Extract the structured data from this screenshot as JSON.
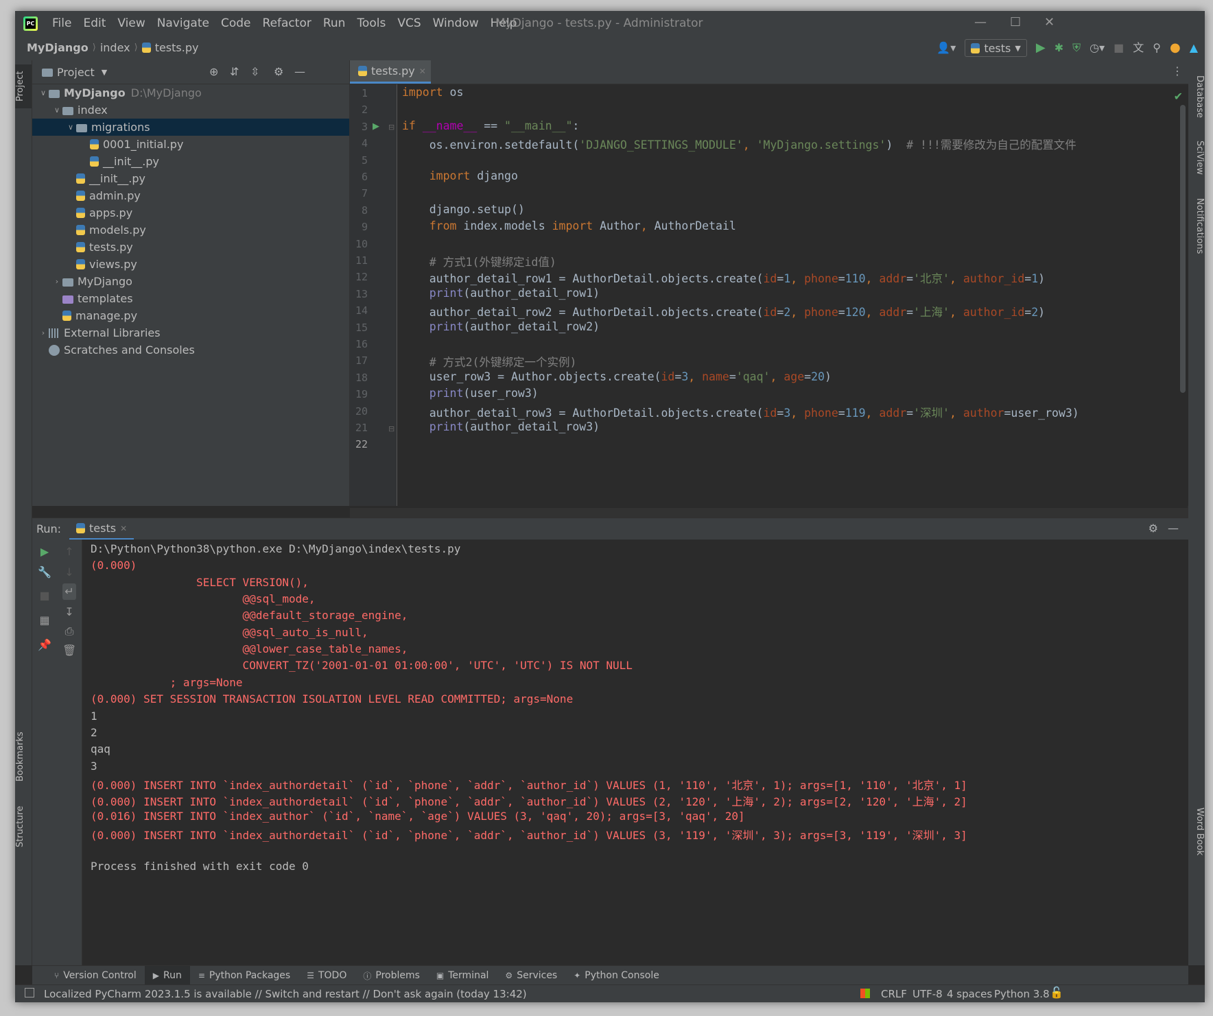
{
  "window": {
    "title": "MyDjango - tests.py - Administrator",
    "menu": [
      "File",
      "Edit",
      "View",
      "Navigate",
      "Code",
      "Refactor",
      "Run",
      "Tools",
      "VCS",
      "Window",
      "Help"
    ]
  },
  "breadcrumb": [
    "MyDjango",
    "index",
    "tests.py"
  ],
  "run_config": "tests",
  "left_stripe": {
    "project": "Project",
    "bookmarks": "Bookmarks",
    "structure": "Structure"
  },
  "right_stripe": {
    "database": "Database",
    "sciview": "SciView",
    "notifications": "Notifications",
    "wordbook": "Word Book"
  },
  "project_panel": {
    "title": "Project",
    "tree": [
      {
        "label": "MyDjango",
        "note": "D:\\MyDjango",
        "type": "folder",
        "depth": 0,
        "open": true
      },
      {
        "label": "index",
        "type": "folder",
        "depth": 1,
        "open": true
      },
      {
        "label": "migrations",
        "type": "folder",
        "depth": 2,
        "open": true
      },
      {
        "label": "0001_initial.py",
        "type": "py",
        "depth": 3
      },
      {
        "label": "__init__.py",
        "type": "py",
        "depth": 3
      },
      {
        "label": "__init__.py",
        "type": "py",
        "depth": 2
      },
      {
        "label": "admin.py",
        "type": "py",
        "depth": 2
      },
      {
        "label": "apps.py",
        "type": "py",
        "depth": 2
      },
      {
        "label": "models.py",
        "type": "py",
        "depth": 2
      },
      {
        "label": "tests.py",
        "type": "py",
        "depth": 2
      },
      {
        "label": "views.py",
        "type": "py",
        "depth": 2
      },
      {
        "label": "MyDjango",
        "type": "folder",
        "depth": 1,
        "open": false
      },
      {
        "label": "templates",
        "type": "purplefolder",
        "depth": 1
      },
      {
        "label": "manage.py",
        "type": "py",
        "depth": 1
      },
      {
        "label": "External Libraries",
        "type": "lib",
        "depth": 0,
        "open": false
      },
      {
        "label": "Scratches and Consoles",
        "type": "scratch",
        "depth": 0
      }
    ]
  },
  "editor": {
    "tab": "tests.py",
    "line_count": 22,
    "code": [
      "import os",
      "",
      "if __name__ == \"__main__\":",
      "    os.environ.setdefault('DJANGO_SETTINGS_MODULE', 'MyDjango.settings')  # !!!需要修改为自己的配置文件",
      "",
      "    import django",
      "",
      "    django.setup()",
      "    from index.models import Author, AuthorDetail",
      "",
      "    # 方式1(外键绑定id值)",
      "    author_detail_row1 = AuthorDetail.objects.create(id=1, phone=110, addr='北京', author_id=1)",
      "    print(author_detail_row1)",
      "    author_detail_row2 = AuthorDetail.objects.create(id=2, phone=120, addr='上海', author_id=2)",
      "    print(author_detail_row2)",
      "",
      "    # 方式2(外键绑定一个实例)",
      "    user_row3 = Author.objects.create(id=3, name='qaq', age=20)",
      "    print(user_row3)",
      "    author_detail_row3 = AuthorDetail.objects.create(id=3, phone=119, addr='深圳', author=user_row3)",
      "    print(author_detail_row3)",
      ""
    ]
  },
  "run_panel": {
    "label": "Run:",
    "tab": "tests",
    "output": [
      {
        "text": "D:\\Python\\Python38\\python.exe D:\\MyDjango\\index\\tests.py",
        "style": "normal"
      },
      {
        "text": "(0.000)",
        "style": "red"
      },
      {
        "text": "                SELECT VERSION(),",
        "style": "red"
      },
      {
        "text": "                       @@sql_mode,",
        "style": "red"
      },
      {
        "text": "                       @@default_storage_engine,",
        "style": "red"
      },
      {
        "text": "                       @@sql_auto_is_null,",
        "style": "red"
      },
      {
        "text": "                       @@lower_case_table_names,",
        "style": "red"
      },
      {
        "text": "                       CONVERT_TZ('2001-01-01 01:00:00', 'UTC', 'UTC') IS NOT NULL",
        "style": "red"
      },
      {
        "text": "            ; args=None",
        "style": "red"
      },
      {
        "text": "(0.000) SET SESSION TRANSACTION ISOLATION LEVEL READ COMMITTED; args=None",
        "style": "red"
      },
      {
        "text": "1",
        "style": "normal"
      },
      {
        "text": "2",
        "style": "normal"
      },
      {
        "text": "qaq",
        "style": "normal"
      },
      {
        "text": "3",
        "style": "normal"
      },
      {
        "text": "(0.000) INSERT INTO `index_authordetail` (`id`, `phone`, `addr`, `author_id`) VALUES (1, '110', '北京', 1); args=[1, '110', '北京', 1]",
        "style": "red"
      },
      {
        "text": "(0.000) INSERT INTO `index_authordetail` (`id`, `phone`, `addr`, `author_id`) VALUES (2, '120', '上海', 2); args=[2, '120', '上海', 2]",
        "style": "red"
      },
      {
        "text": "(0.016) INSERT INTO `index_author` (`id`, `name`, `age`) VALUES (3, 'qaq', 20); args=[3, 'qaq', 20]",
        "style": "red"
      },
      {
        "text": "(0.000) INSERT INTO `index_authordetail` (`id`, `phone`, `addr`, `author_id`) VALUES (3, '119', '深圳', 3); args=[3, '119', '深圳', 3]",
        "style": "red"
      },
      {
        "text": "",
        "style": "normal"
      },
      {
        "text": "Process finished with exit code 0",
        "style": "normal"
      }
    ]
  },
  "tool_tabs": [
    {
      "label": "Version Control",
      "icon": "branch-icon",
      "active": false
    },
    {
      "label": "Run",
      "icon": "play-icon",
      "active": true
    },
    {
      "label": "Python Packages",
      "icon": "layers-icon",
      "active": false
    },
    {
      "label": "TODO",
      "icon": "list-icon",
      "active": false
    },
    {
      "label": "Problems",
      "icon": "info-icon",
      "active": false
    },
    {
      "label": "Terminal",
      "icon": "terminal-icon",
      "active": false
    },
    {
      "label": "Services",
      "icon": "services-icon",
      "active": false
    },
    {
      "label": "Python Console",
      "icon": "python-icon",
      "active": false
    }
  ],
  "status": {
    "message": "Localized PyCharm 2023.1.5 is available // Switch and restart // Don't ask again (today 13:42)",
    "line_sep": "CRLF",
    "encoding": "UTF-8",
    "indent": "4 spaces",
    "interpreter": "Python 3.8"
  },
  "colors": {
    "accent": "#4a88c7",
    "run_green": "#59a869",
    "error_red": "#ff6b68",
    "selection": "#0d293e"
  }
}
